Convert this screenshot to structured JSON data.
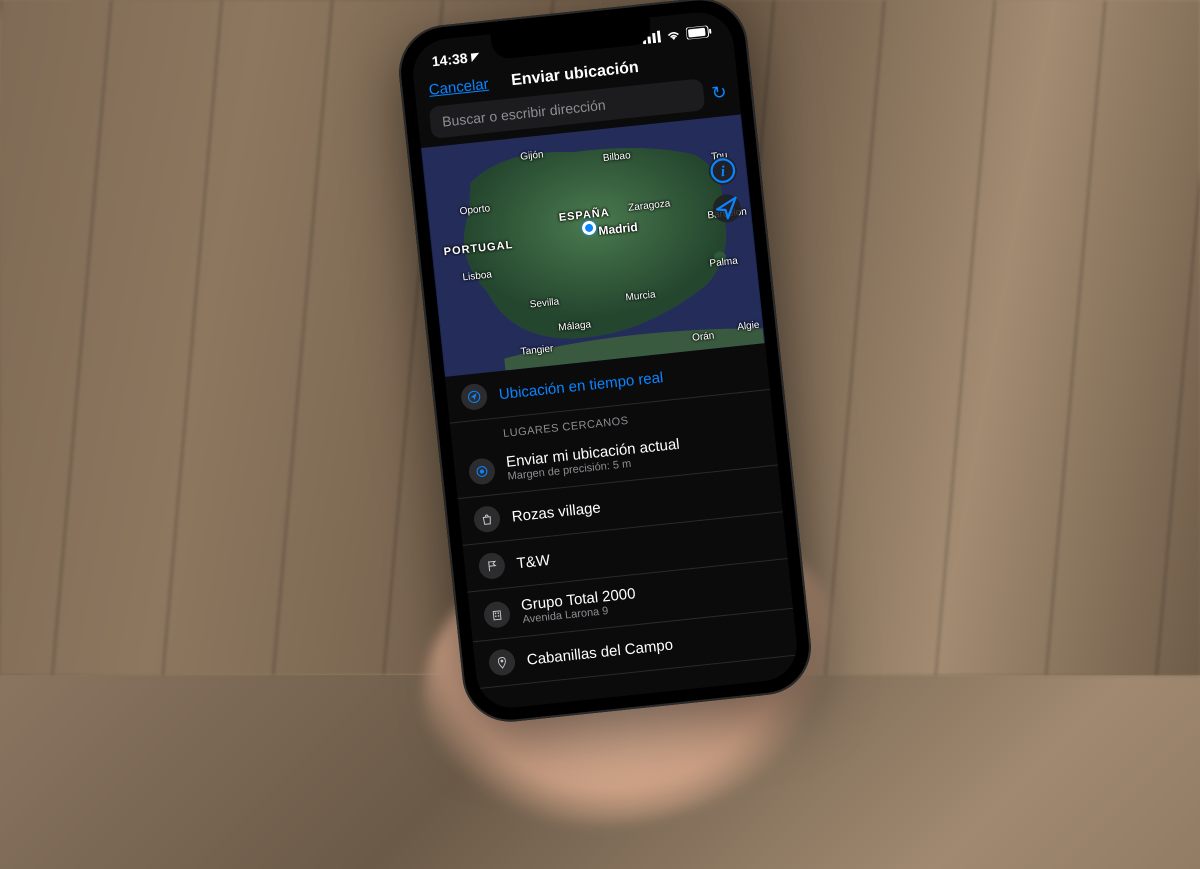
{
  "status": {
    "time": "14:38",
    "location_arrow": "➤"
  },
  "nav": {
    "cancel": "Cancelar",
    "title": "Enviar ubicación"
  },
  "search": {
    "placeholder": "Buscar o escribir dirección"
  },
  "map": {
    "country_spain": "ESPAÑA",
    "country_portugal": "PORTUGAL",
    "cities": {
      "gijon": "Gijón",
      "bilbao": "Bilbao",
      "tou": "Tou",
      "oporto": "Oporto",
      "zaragoza": "Zaragoza",
      "madrid": "Madrid",
      "barcelona": "Barcelon",
      "lisboa": "Lisboa",
      "palma": "Palma",
      "sevilla": "Sevilla",
      "murcia": "Murcia",
      "malaga": "Málaga",
      "tangier": "Tangier",
      "oran": "Orán",
      "algie": "Algie"
    }
  },
  "live": {
    "label": "Ubicación en tiempo real"
  },
  "section": {
    "nearby": "LUGARES CERCANOS"
  },
  "current": {
    "label": "Enviar mi ubicación actual",
    "sub": "Margen de precisión: 5 m"
  },
  "places": [
    {
      "label": "Rozas village"
    },
    {
      "label": "T&W"
    },
    {
      "label": "Grupo Total 2000",
      "sub": "Avenida Larona 9"
    },
    {
      "label": "Cabanillas del Campo"
    }
  ]
}
